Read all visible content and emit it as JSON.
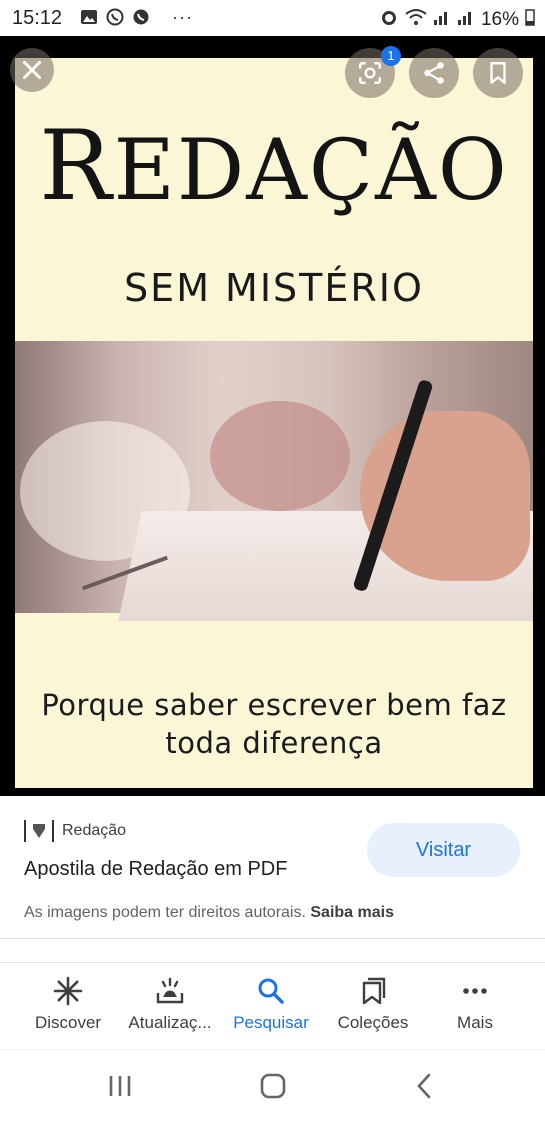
{
  "status_bar": {
    "time": "15:12",
    "more": "···",
    "battery": "16%",
    "icons_left": [
      "image-icon",
      "whatsapp-icon",
      "viber-icon"
    ],
    "icons_right": [
      "alarm-icon",
      "wifi-icon",
      "signal-icon",
      "signal-icon",
      "battery-icon"
    ]
  },
  "poster": {
    "title_first": "R",
    "title_rest": "EDAÇÃO",
    "subtitle": "SEM MISTÉRIO",
    "tagline_line1": "Porque saber escrever bem faz",
    "tagline_line2": "toda diferença",
    "background": "#fbf6d6"
  },
  "overlay": {
    "close_icon": "close-icon",
    "lens_badge": "1",
    "lens_icon": "google-lens-icon",
    "share_icon": "share-icon",
    "bookmark_icon": "bookmark-icon"
  },
  "result": {
    "source_name": "Redação",
    "title": "Apostila de Redação em PDF",
    "visit_label": "Visitar",
    "rights_text": "As imagens podem ter direitos autorais.",
    "rights_link": "Saiba mais",
    "accent": "#1a73e8"
  },
  "bottom_nav": {
    "items": [
      {
        "label": "Discover",
        "icon": "asterisk-icon"
      },
      {
        "label": "Atualizaç...",
        "icon": "updates-icon"
      },
      {
        "label": "Pesquisar",
        "icon": "search-icon",
        "active": true
      },
      {
        "label": "Coleções",
        "icon": "collections-icon"
      },
      {
        "label": "Mais",
        "icon": "more-dots-icon"
      }
    ]
  },
  "system_nav": [
    "recent-apps-icon",
    "home-icon",
    "back-icon"
  ]
}
